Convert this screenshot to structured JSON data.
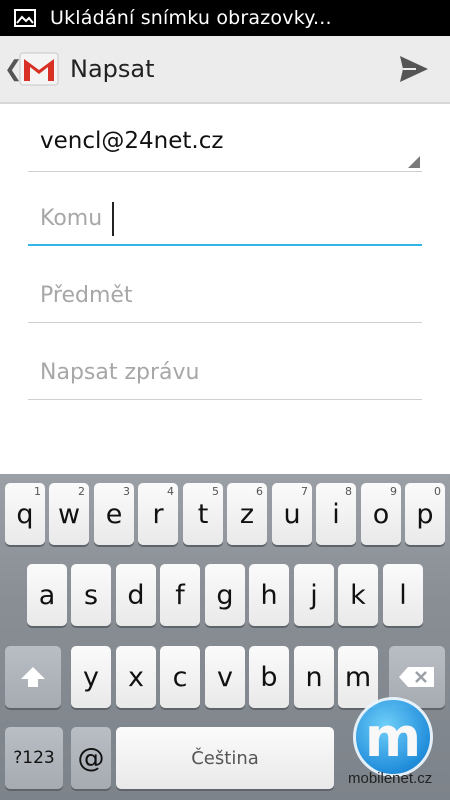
{
  "status_bar": {
    "text": "Ukládání snímku obrazovky..."
  },
  "action_bar": {
    "title": "Napsat",
    "back_glyph": "❮",
    "icons": [
      "chevron-left-icon",
      "gmail-icon",
      "send-icon"
    ]
  },
  "compose": {
    "from_value": "vencl@24net.cz",
    "to_placeholder": "Komu",
    "to_value": "",
    "subject_placeholder": "Předmět",
    "subject_value": "",
    "body_placeholder": "Napsat zprávu",
    "body_value": ""
  },
  "keyboard": {
    "row1": [
      {
        "label": "q",
        "hint": "1"
      },
      {
        "label": "w",
        "hint": "2"
      },
      {
        "label": "e",
        "hint": "3"
      },
      {
        "label": "r",
        "hint": "4"
      },
      {
        "label": "t",
        "hint": "5"
      },
      {
        "label": "z",
        "hint": "6"
      },
      {
        "label": "u",
        "hint": "7"
      },
      {
        "label": "i",
        "hint": "8"
      },
      {
        "label": "o",
        "hint": "9"
      },
      {
        "label": "p",
        "hint": "0"
      }
    ],
    "row2": [
      "a",
      "s",
      "d",
      "f",
      "g",
      "h",
      "j",
      "k",
      "l"
    ],
    "row3": [
      "y",
      "x",
      "c",
      "v",
      "b",
      "n",
      "m"
    ],
    "row4": {
      "symbols": "?123",
      "at": "@",
      "space": "Čeština"
    },
    "icons": [
      "shift-icon",
      "backspace-icon"
    ]
  },
  "watermark": {
    "logo_letter": "m",
    "text": "mobilenet.cz"
  },
  "colors": {
    "accent": "#33b5e5",
    "action_bar_bg": "#ececec",
    "keyboard_bg": "#888e94"
  }
}
